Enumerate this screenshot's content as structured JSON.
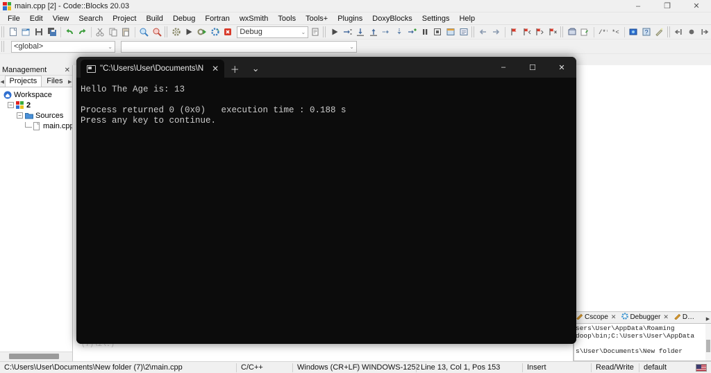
{
  "window": {
    "title": "main.cpp [2] - Code::Blocks 20.03",
    "icon": "codeblocks-logo-icon",
    "controls": {
      "minimize": "–",
      "restore": "❐",
      "close": "✕"
    }
  },
  "menubar": {
    "items": [
      {
        "label": "File"
      },
      {
        "label": "Edit"
      },
      {
        "label": "View"
      },
      {
        "label": "Search"
      },
      {
        "label": "Project"
      },
      {
        "label": "Build"
      },
      {
        "label": "Debug"
      },
      {
        "label": "Fortran"
      },
      {
        "label": "wxSmith"
      },
      {
        "label": "Tools"
      },
      {
        "label": "Tools+"
      },
      {
        "label": "Plugins"
      },
      {
        "label": "DoxyBlocks"
      },
      {
        "label": "Settings"
      },
      {
        "label": "Help"
      }
    ]
  },
  "toolbar": {
    "build_target": "Debug",
    "caret": "⌄",
    "main_icons": [
      "new-file-icon",
      "open-file-icon",
      "save-icon",
      "save-all-icon",
      "undo-icon",
      "redo-icon",
      "cut-icon",
      "copy-icon",
      "paste-icon",
      "find-icon",
      "replace-icon"
    ],
    "compile_icons": [
      "build-icon",
      "run-icon",
      "build-and-run-icon",
      "rebuild-icon",
      "abort-icon"
    ],
    "debug_icons": [
      "debug-continue-icon",
      "next-line-icon",
      "step-into-icon",
      "step-out-icon",
      "next-instruction-icon",
      "step-into-instruction-icon",
      "run-to-cursor-icon",
      "break-debugger-icon",
      "stop-debugger-icon",
      "debugging-windows-icon",
      "various-info-icon"
    ],
    "nav_icons": [
      "back-icon",
      "forward-icon",
      "toggle-bookmark-icon",
      "previous-bookmark-icon",
      "next-bookmark-icon",
      "clear-bookmarks-icon"
    ],
    "doxy_icons": [
      "extract-documentation-icon",
      "run-doxywizard-icon",
      "block-comment-icon",
      "line-comment-icon",
      "doxyblocks-config-icon",
      "doxyblocks-help-icon",
      "doxyblocks-wizard-icon"
    ],
    "breakpoint_icons": [
      "goto-previous-changed-line-icon",
      "toggle-breakpoint-icon",
      "goto-next-changed-line-icon"
    ]
  },
  "toolbar2": {
    "scope": "<global>",
    "function": "",
    "caret": "⌄"
  },
  "management": {
    "title": "Management",
    "close": "✕",
    "left_arrow": "◀",
    "right_arrow": "▶",
    "tabs": [
      {
        "label": "Projects",
        "active": true
      },
      {
        "label": "Files",
        "active": false
      }
    ],
    "tree": {
      "workspace": {
        "label": "Workspace",
        "icon": "workspace-icon"
      },
      "project": {
        "label": "2",
        "icon": "project-icon",
        "expander": "−"
      },
      "folder": {
        "label": "Sources",
        "icon": "folder-icon",
        "expander": "−"
      },
      "file": {
        "label": "main.cpp",
        "icon": "source-file-icon"
      }
    }
  },
  "console": {
    "tab": {
      "title": "\"C:\\Users\\User\\Documents\\N",
      "icon": "terminal-icon",
      "close": "✕"
    },
    "new_tab": "＋",
    "dropdown": "⌄",
    "controls": {
      "minimize": "–",
      "maximize": "☐",
      "close": "✕"
    },
    "output": "Hello The Age is: 13\n\nProcess returned 0 (0x0)   execution time : 0.188 s\nPress any key to continue.\n",
    "background_color": "#0c0c0c",
    "titlebar_color": "#1f1f1f",
    "text_color": "#cccccc"
  },
  "editor": {
    "faint_text": "(7)\\2\\.)"
  },
  "logs": {
    "tabs": [
      {
        "label": "Cscope",
        "icon": "cscope-icon",
        "close": "✕",
        "active": false
      },
      {
        "label": "Debugger",
        "icon": "debugger-gear-icon",
        "close": "✕",
        "active": false
      },
      {
        "label": "D…",
        "icon": "doxyblocks-icon",
        "close": "",
        "active": false
      }
    ],
    "more_arrow": "▶",
    "lines": [
      "sers\\User\\AppData\\Roaming",
      "doop\\bin;C:\\Users\\User\\AppData",
      "",
      "s\\User\\Documents\\New folder"
    ]
  },
  "statusbar": {
    "path": "C:\\Users\\User\\Documents\\New folder (7)\\2\\main.cpp",
    "language": "C/C++",
    "line_ending": "Windows (CR+LF)",
    "encoding": "WINDOWS-1252",
    "caret": "Line 13, Col 1, Pos 153",
    "insert_mode": "Insert",
    "permission": "Read/Write",
    "profile": "default",
    "keyboard_layout_icon": "us-flag-icon"
  }
}
